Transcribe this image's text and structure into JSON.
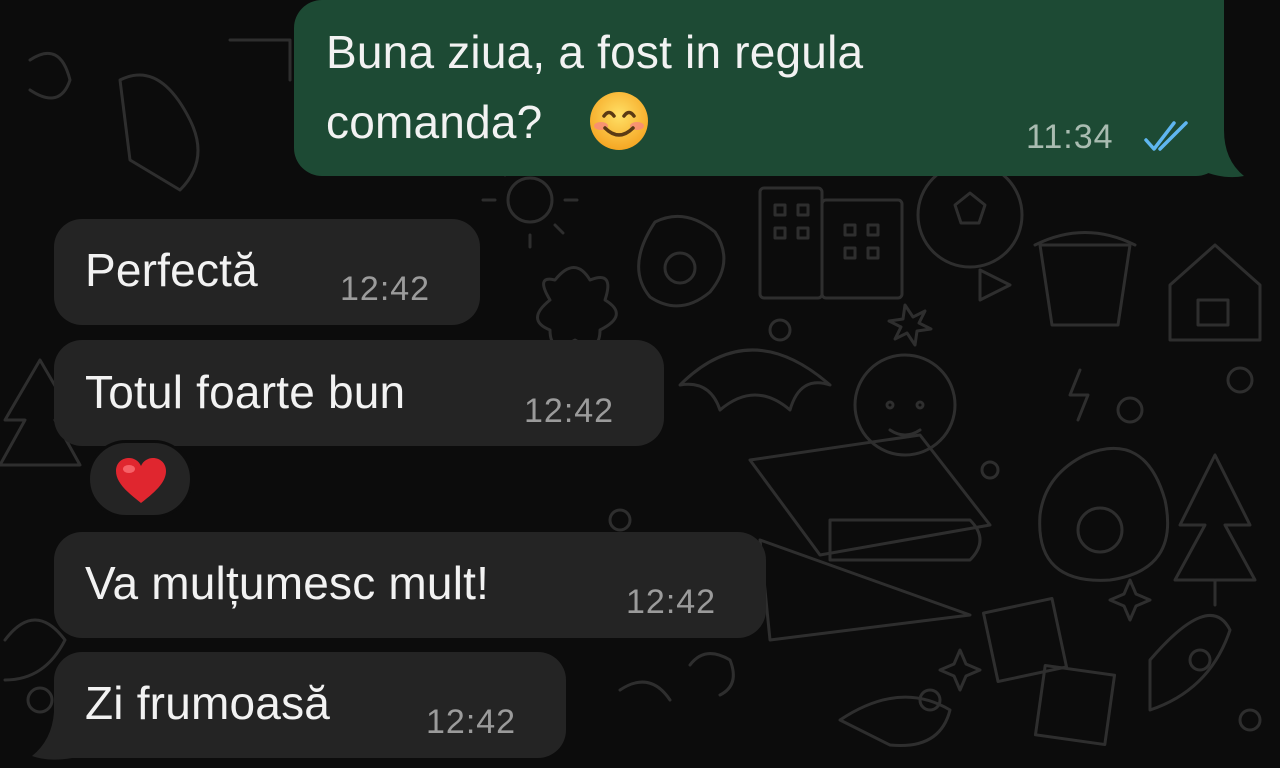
{
  "colors": {
    "background": "#0c0c0c",
    "incoming_bubble": "#242424",
    "outgoing_bubble": "#1d4a34",
    "read_ticks": "#5fb6f0",
    "heart": "#e0262f"
  },
  "messages": [
    {
      "direction": "outgoing",
      "lines": [
        "Buna ziua, a fost in regula",
        "comanda?"
      ],
      "emoji": "smiling-face-emoji",
      "time": "11:34",
      "status": "read-double-check-icon"
    },
    {
      "direction": "incoming",
      "text": "Perfectă",
      "time": "12:42"
    },
    {
      "direction": "incoming",
      "text": "Totul foarte bun",
      "time": "12:42",
      "reaction": "heart-emoji"
    },
    {
      "direction": "incoming",
      "text": "Va mulțumesc mult!",
      "time": "12:42"
    },
    {
      "direction": "incoming",
      "text": "Zi frumoasă",
      "time": "12:42"
    }
  ]
}
